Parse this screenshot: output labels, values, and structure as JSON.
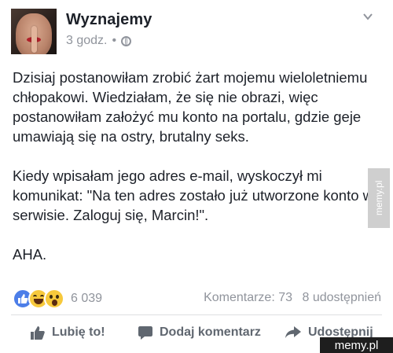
{
  "post": {
    "page_name": "Wyznajemy",
    "time": "3 godz.",
    "separator": "•",
    "icons": {
      "privacy": "globe-icon",
      "menu": "chevron-down-icon"
    },
    "paragraphs": [
      "Dzisiaj postanowiłam zrobić żart mojemu wieloletniemu chłopakowi. Wiedziałam, że się nie obrazi, więc postanowiłam założyć mu konto na portalu, gdzie geje umawiają się na ostry, brutalny seks.",
      "Kiedy wpisałam jego adres e-mail, wyskoczył mi komunikat: \"Na ten adres zostało już utworzone konto w serwisie. Zaloguj się, Marcin!\".",
      "AHA."
    ]
  },
  "reactions": {
    "types": [
      "like",
      "haha",
      "wow"
    ],
    "count": "6 039",
    "comments": "Komentarze: 73",
    "shares": "8 udostępnień"
  },
  "actions": {
    "like": "Lubię to!",
    "comment": "Dodaj komentarz",
    "share": "Udostępnij"
  },
  "watermarks": {
    "side": "memy.pl",
    "corner": "memy.pl"
  },
  "colors": {
    "text": "#1d2129",
    "meta": "#90949c",
    "action": "#606770",
    "like_blue": "#4c7ee8",
    "emoji_yellow": "#f7c93c"
  }
}
